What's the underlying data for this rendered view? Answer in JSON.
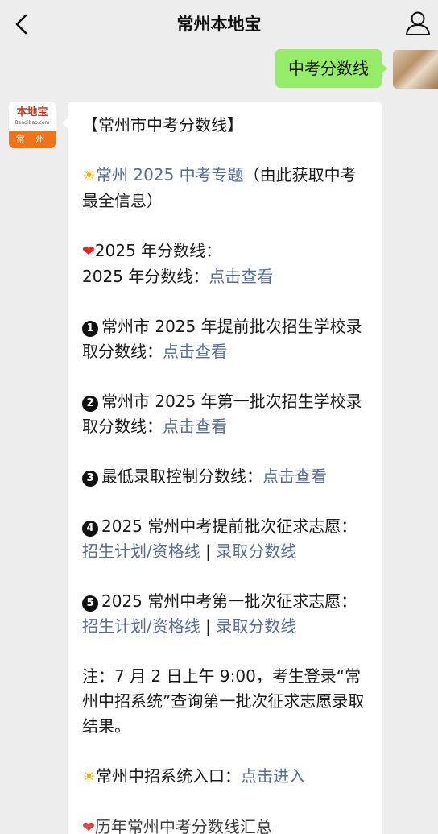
{
  "header": {
    "title": "常州本地宝",
    "back_icon": "chevron-left-icon",
    "profile_icon": "person-icon"
  },
  "chat": {
    "outgoing_message": "中考分数线",
    "bot_avatar": {
      "logo_text": "本地宝",
      "site_text": "Bendibao.com",
      "city_text": "常 州"
    },
    "reply": {
      "heading": "【常州市中考分数线】",
      "topic_icon": "sun-icon",
      "topic_link": "常州 2025 中考专题",
      "topic_note": "（由此获取中考最全信息）",
      "score_icon": "heart-icon",
      "score_heading": "2025 年分数线：",
      "score_line_label": "2025 年分数线：",
      "score_line_link": "点击查看",
      "item1_number": "1",
      "item1_text": "常州市 2025 年提前批次招生学校录取分数线：",
      "item1_link": "点击查看",
      "item2_number": "2",
      "item2_text": "常州市 2025 年第一批次招生学校录取分数线：",
      "item2_link": "点击查看",
      "item3_number": "3",
      "item3_text": "最低录取控制分数线：",
      "item3_link": "点击查看",
      "item4_number": "4",
      "item4_text": "2025 常州中考提前批次征求志愿：",
      "item4_link_a": "招生计划/资格线",
      "item4_sep": " | ",
      "item4_link_b": "录取分数线",
      "item5_number": "5",
      "item5_text": "2025 常州中考第一批次征求志愿：",
      "item5_link_a": "招生计划/资格线",
      "item5_sep": " | ",
      "item5_link_b": "录取分数线",
      "note": "注：7 月 2 日上午 9:00，考生登录“常州中招系统”查询第一批次征求志愿录取结果。",
      "entry_icon": "sun-icon",
      "entry_label": "常州中招系统入口：",
      "entry_link": "点击进入",
      "cut_icon": "heart-icon",
      "cut_text": "历年常州中考分数线汇总"
    }
  },
  "colors": {
    "link": "#576b95",
    "outgoing_bubble": "#95ec69",
    "background": "#ededed",
    "brand_orange": "#f07318"
  }
}
